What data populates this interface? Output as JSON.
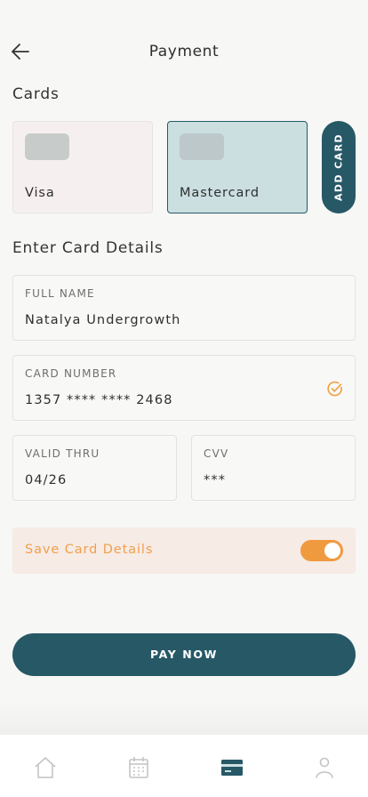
{
  "header": {
    "title": "Payment",
    "back_icon": "arrow-left-icon"
  },
  "cards": {
    "section_title": "Cards",
    "items": [
      {
        "label": "Visa",
        "selected": false
      },
      {
        "label": "Mastercard",
        "selected": true
      }
    ],
    "add_label": "ADD CARD"
  },
  "details": {
    "section_title": "Enter Card Details",
    "full_name": {
      "label": "FULL NAME",
      "value": "Natalya Undergrowth"
    },
    "card_number": {
      "label": "CARD NUMBER",
      "value": "1357 **** **** 2468",
      "status_icon": "check-circle-icon"
    },
    "valid_thru": {
      "label": "VALID THRU",
      "value": "04/26"
    },
    "cvv": {
      "label": "CVV",
      "value": "***"
    }
  },
  "save": {
    "label": "Save Card Details",
    "enabled": true
  },
  "pay": {
    "label": "PAY NOW"
  },
  "nav": {
    "items": [
      {
        "icon": "home-icon",
        "active": false
      },
      {
        "icon": "calendar-icon",
        "active": false
      },
      {
        "icon": "card-icon",
        "active": true
      },
      {
        "icon": "profile-icon",
        "active": false
      }
    ]
  },
  "colors": {
    "primary": "#275866",
    "accent": "#f09a40",
    "selected_card_bg": "#cbdfe1",
    "save_row_bg": "#f6ebe5"
  }
}
